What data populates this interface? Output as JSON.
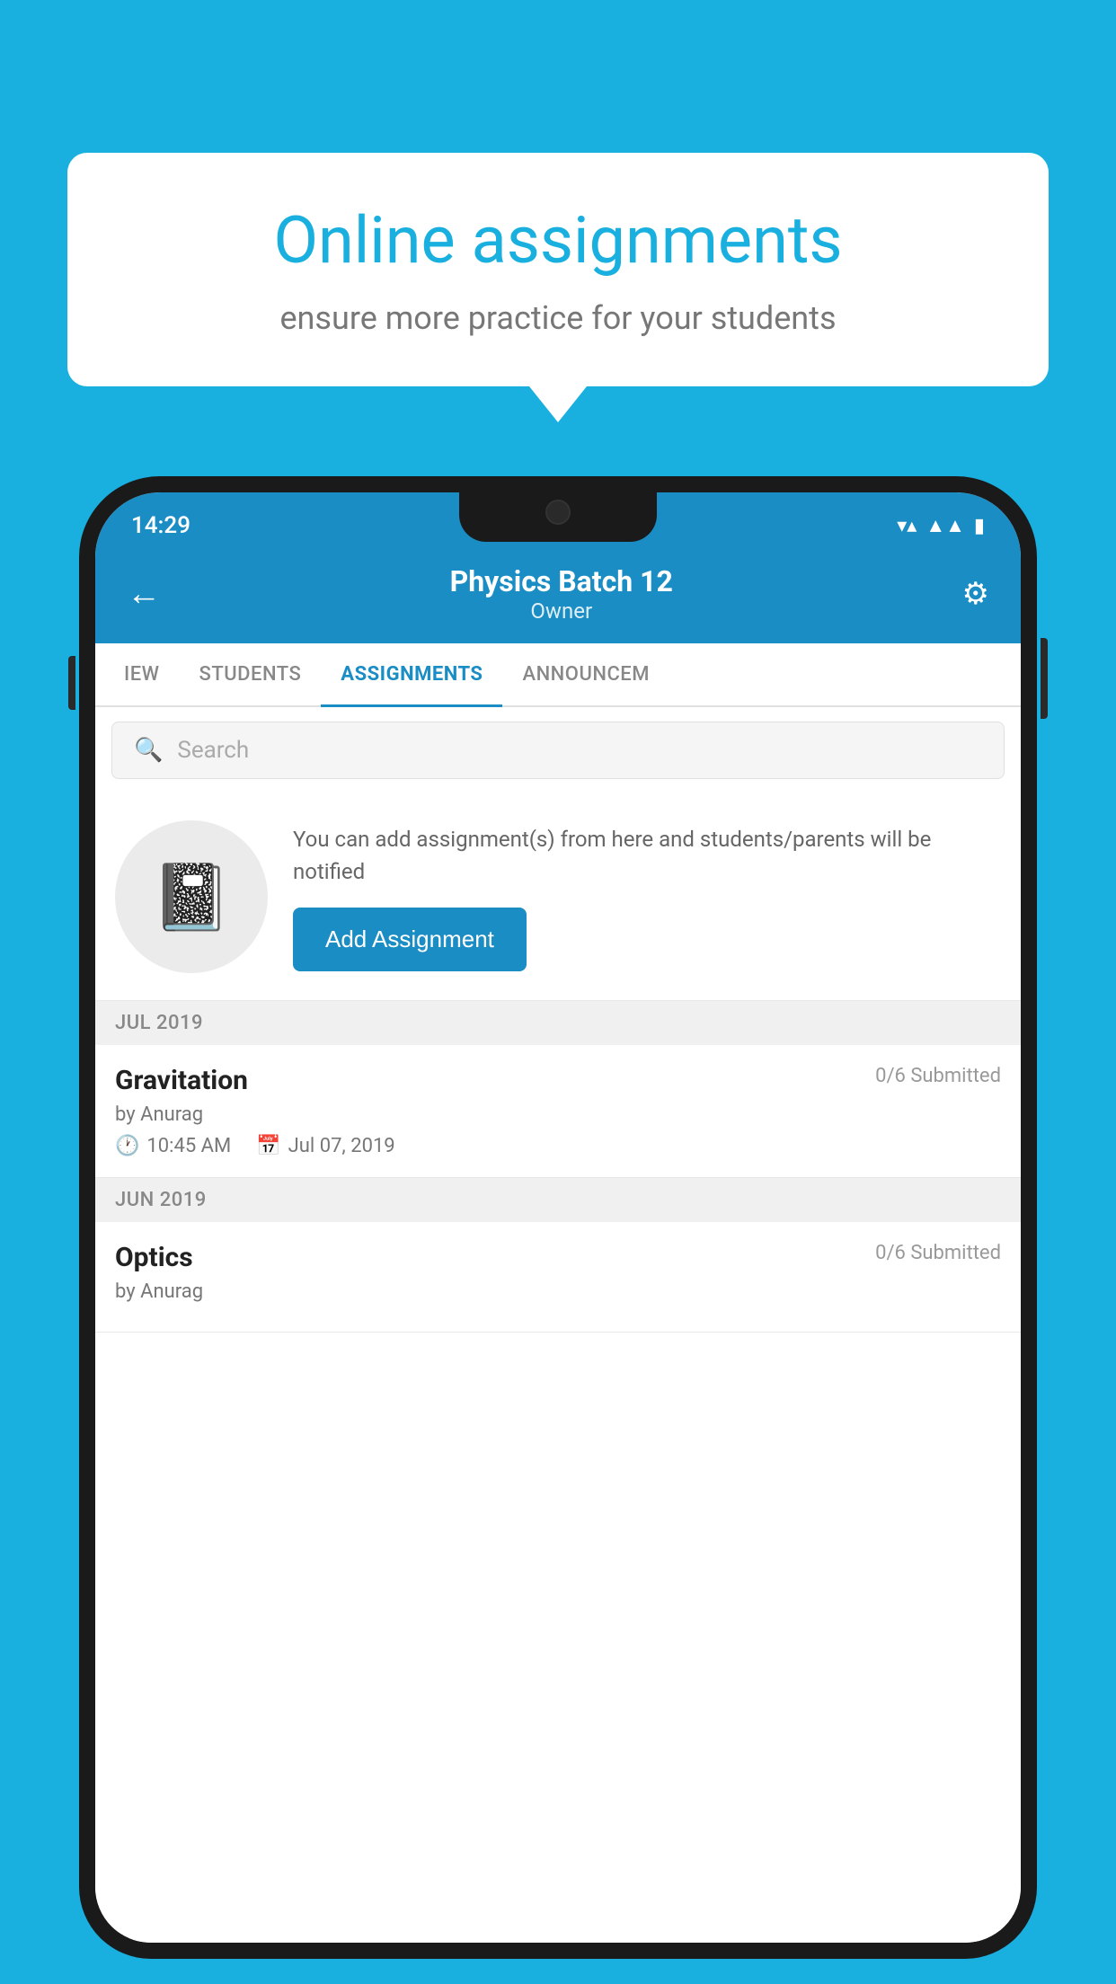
{
  "background_color": "#19b0e0",
  "speech_bubble": {
    "title": "Online assignments",
    "subtitle": "ensure more practice for your students"
  },
  "status_bar": {
    "time": "14:29",
    "wifi_icon": "▼",
    "signal_icon": "◀",
    "battery_icon": "▮"
  },
  "header": {
    "title": "Physics Batch 12",
    "subtitle": "Owner",
    "back_label": "←",
    "settings_label": "⚙"
  },
  "tabs": [
    {
      "label": "IEW",
      "active": false
    },
    {
      "label": "STUDENTS",
      "active": false
    },
    {
      "label": "ASSIGNMENTS",
      "active": true
    },
    {
      "label": "ANNOUNCEM",
      "active": false
    }
  ],
  "search": {
    "placeholder": "Search"
  },
  "add_assignment": {
    "description": "You can add assignment(s) from here and students/parents will be notified",
    "button_label": "Add Assignment"
  },
  "sections": [
    {
      "label": "JUL 2019",
      "assignments": [
        {
          "title": "Gravitation",
          "submitted": "0/6 Submitted",
          "author": "by Anurag",
          "time": "10:45 AM",
          "date": "Jul 07, 2019"
        }
      ]
    },
    {
      "label": "JUN 2019",
      "assignments": [
        {
          "title": "Optics",
          "submitted": "0/6 Submitted",
          "author": "by Anurag",
          "time": "",
          "date": ""
        }
      ]
    }
  ]
}
